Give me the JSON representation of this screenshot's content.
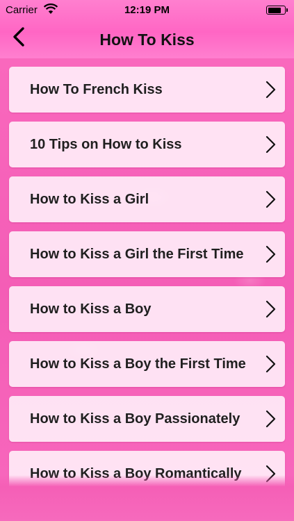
{
  "status_bar": {
    "carrier": "Carrier",
    "time": "12:19 PM",
    "battery_level": 0.85,
    "wifi_icon": "wifi-icon",
    "battery_icon": "battery-icon"
  },
  "nav": {
    "title": "How To Kiss",
    "back_icon": "chevron-left-icon"
  },
  "list": {
    "chevron_icon": "chevron-right-icon",
    "items": [
      {
        "label": "How To French Kiss"
      },
      {
        "label": "10 Tips on How to Kiss"
      },
      {
        "label": "How to Kiss a Girl"
      },
      {
        "label": "How to Kiss a Girl the First Time"
      },
      {
        "label": "How to Kiss a Boy"
      },
      {
        "label": "How to Kiss a Boy the First Time"
      },
      {
        "label": "How to Kiss a Boy Passionately"
      },
      {
        "label": "How to Kiss a Boy Romantically"
      }
    ]
  },
  "colors": {
    "nav_background": "#ff6fc8",
    "page_background": "#f55fb6",
    "row_background": "#fff0f9",
    "text": "#1f1f1f"
  }
}
